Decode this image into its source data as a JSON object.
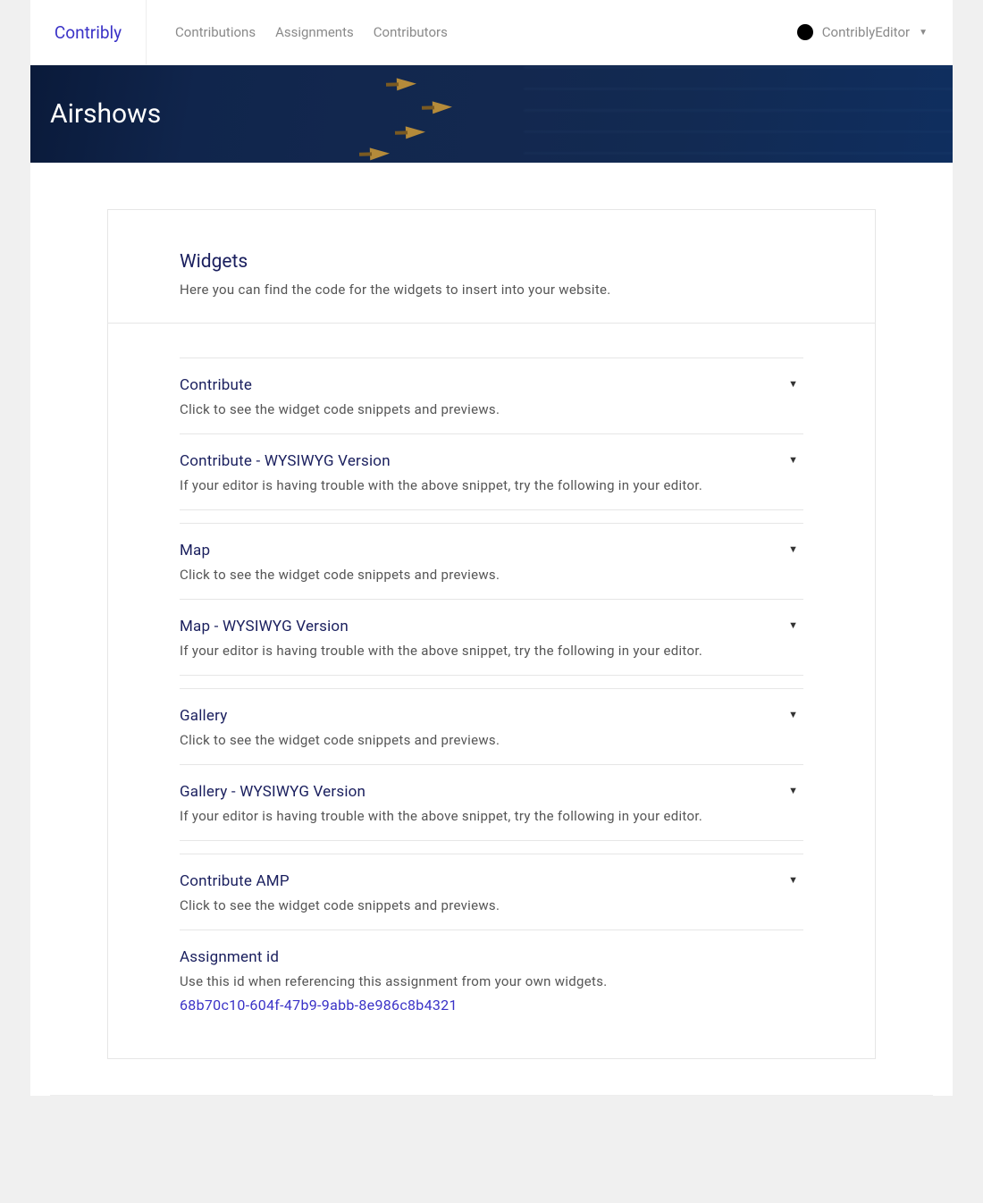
{
  "brand": "Contribly",
  "nav": {
    "contributions": "Contributions",
    "assignments": "Assignments",
    "contributors": "Contributors"
  },
  "user": {
    "name": "ContriblyEditor"
  },
  "hero": {
    "title": "Airshows"
  },
  "panel": {
    "title": "Widgets",
    "subtitle": "Here you can find the code for the widgets to insert into your website."
  },
  "widgets": [
    {
      "title": "Contribute",
      "desc": "Click to see the widget code snippets and previews."
    },
    {
      "title": "Contribute - WYSIWYG Version",
      "desc": "If your editor is having trouble with the above snippet, try the following in your editor."
    },
    {
      "title": "Map",
      "desc": "Click to see the widget code snippets and previews."
    },
    {
      "title": "Map - WYSIWYG Version",
      "desc": "If your editor is having trouble with the above snippet, try the following in your editor."
    },
    {
      "title": "Gallery",
      "desc": "Click to see the widget code snippets and previews."
    },
    {
      "title": "Gallery - WYSIWYG Version",
      "desc": "If your editor is having trouble with the above snippet, try the following in your editor."
    },
    {
      "title": "Contribute AMP",
      "desc": "Click to see the widget code snippets and previews."
    }
  ],
  "assignment": {
    "label": "Assignment id",
    "desc": "Use this id when referencing this assignment from your own widgets.",
    "id": "68b70c10-604f-47b9-9abb-8e986c8b4321"
  }
}
